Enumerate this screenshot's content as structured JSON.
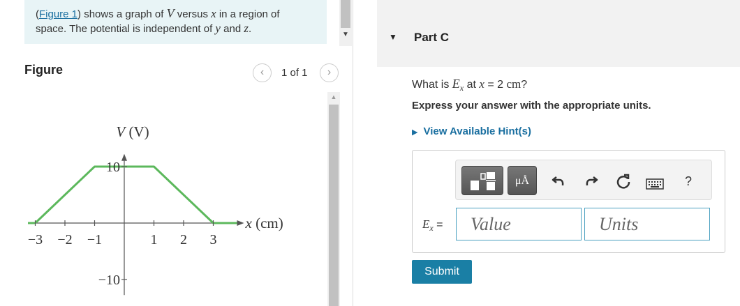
{
  "intro": {
    "link_text": "Figure 1",
    "text_a": ") shows a graph of ",
    "var_v": "V",
    "text_b": " versus ",
    "var_x": "x",
    "text_c": " in a region of",
    "text_d": "space. The potential is independent of ",
    "var_y": "y",
    "text_e": " and ",
    "var_z": "z",
    "text_f": "."
  },
  "figure": {
    "heading": "Figure",
    "pager": "1 of 1",
    "prev_icon": "chevron-left-icon",
    "next_icon": "chevron-right-icon"
  },
  "chart_data": {
    "type": "line",
    "title": "",
    "xlabel": "x (cm)",
    "ylabel": "V (V)",
    "xlim": [
      -3.8,
      3.8
    ],
    "ylim": [
      -12,
      12
    ],
    "x_ticks": [
      "−3",
      "−2",
      "−1",
      "1",
      "2",
      "3"
    ],
    "x_tick_values": [
      -3,
      -2,
      -1,
      1,
      2,
      3
    ],
    "y_ticks": [
      "10",
      "−10"
    ],
    "y_tick_values": [
      10,
      -10
    ],
    "grid": false,
    "line_color": "#5cb85c",
    "series": [
      {
        "x": [
          -3.8,
          -3,
          -1,
          1,
          3,
          3.8
        ],
        "y": [
          0,
          0,
          10,
          10,
          0,
          0
        ]
      }
    ]
  },
  "part": {
    "toggle_icon": "caret-down-icon",
    "title": "Part C",
    "question_a": "What is ",
    "question_var": "E",
    "question_sub": "x",
    "question_b": " at ",
    "question_var2": "x",
    "question_c": " = 2 ",
    "question_unit": "cm",
    "question_d": "?",
    "instruction": "Express your answer with the appropriate units.",
    "hint_label": "View Available Hint(s)",
    "hint_icon": "caret-right-icon"
  },
  "toolbar": {
    "units_label": "μÅ",
    "undo_icon": "undo-icon",
    "redo_icon": "redo-icon",
    "reset_icon": "reset-icon",
    "keyboard_icon": "keyboard-icon",
    "help_label": "?"
  },
  "answer": {
    "label_var": "E",
    "label_sub": "x",
    "label_eq": " =",
    "value_placeholder": "Value",
    "units_placeholder": "Units",
    "submit_label": "Submit"
  },
  "colors": {
    "accent": "#1a7fa5",
    "link": "#1a6fa0",
    "intro_bg": "#e8f4f6"
  }
}
